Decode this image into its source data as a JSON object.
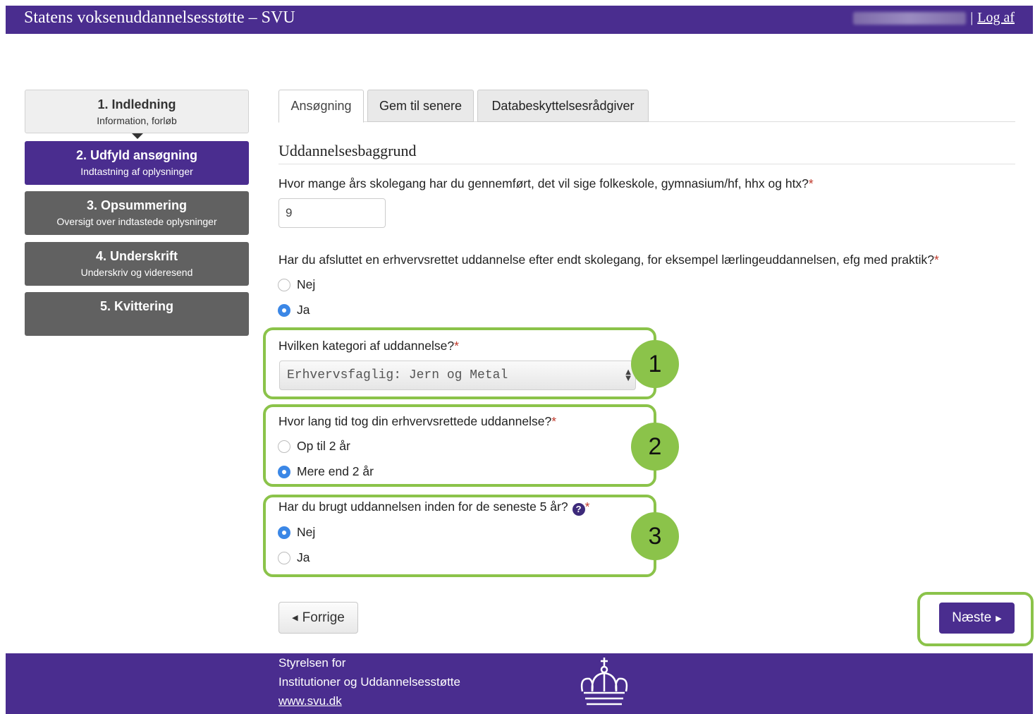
{
  "header": {
    "title": "Statens voksenuddannelsesstøtte – SVU",
    "separator": "|",
    "logout_label": "Log af"
  },
  "steps": [
    {
      "title": "1. Indledning",
      "subtitle": "Information, forløb"
    },
    {
      "title": "2. Udfyld ansøgning",
      "subtitle": "Indtastning af oplysninger"
    },
    {
      "title": "3. Opsummering",
      "subtitle": "Oversigt over indtastede oplysninger"
    },
    {
      "title": "4. Underskrift",
      "subtitle": "Underskriv og videresend"
    },
    {
      "title": "5. Kvittering",
      "subtitle": ""
    }
  ],
  "tabs": [
    {
      "label": "Ansøgning",
      "active": true
    },
    {
      "label": "Gem til senere",
      "active": false
    },
    {
      "label": "Databeskyttelsesrådgiver",
      "active": false
    }
  ],
  "section": {
    "title": "Uddannelsesbaggrund"
  },
  "questions": {
    "q1": {
      "label": "Hvor mange års skolegang har du gennemført, det vil sige folkeskole, gymnasium/hf, hhx og htx?",
      "value": "9"
    },
    "q2": {
      "label": "Har du afsluttet en erhvervsrettet uddannelse efter endt skolegang, for eksempel lærlingeuddannelsen, efg med praktik?",
      "options": [
        "Nej",
        "Ja"
      ],
      "selected": "Ja"
    },
    "q3": {
      "label": "Hvilken kategori af uddannelse?",
      "selected_value": "Erhvervsfaglig: Jern og Metal"
    },
    "q4": {
      "label": "Hvor lang tid tog din erhvervsrettede uddannelse?",
      "options": [
        "Op til 2 år",
        "Mere end 2 år"
      ],
      "selected": "Mere end 2 år"
    },
    "q5": {
      "label": "Har du brugt uddannelsen inden for de seneste 5 år?",
      "options": [
        "Nej",
        "Ja"
      ],
      "selected": "Nej"
    }
  },
  "required_mark": "*",
  "help_glyph": "?",
  "callouts": [
    "1",
    "2",
    "3"
  ],
  "nav": {
    "prev_label": "Forrige",
    "next_label": "Næste"
  },
  "footer": {
    "line1": "Styrelsen for",
    "line2": "Institutioner og Uddannelsesstøtte",
    "link": "www.svu.dk"
  },
  "colors": {
    "brand": "#4a2d8f",
    "step_inactive": "#616161",
    "radio_selected": "#3b87e6",
    "callout": "#8bc34a",
    "required": "#c0392b"
  },
  "icons": {
    "help": "question-circle-icon",
    "crown": "royal-crown-logo",
    "prev": "caret-left-icon",
    "next": "caret-right-icon"
  }
}
